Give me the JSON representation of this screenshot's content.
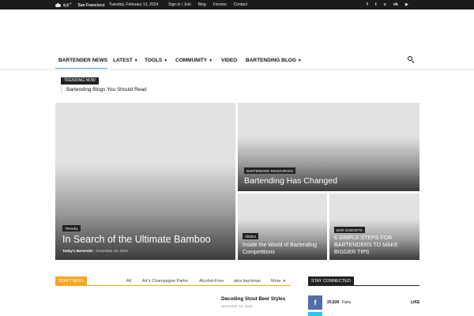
{
  "topbar": {
    "temperature": "9.9",
    "temp_unit": "F",
    "city": "San Francisco",
    "date": "Tuesday, February 13, 2024",
    "links": [
      "Sign in / Join",
      "Blog",
      "Forums",
      "Contact"
    ],
    "social": [
      {
        "icon": "facebook-icon",
        "glyph": "f"
      },
      {
        "icon": "twitter-icon",
        "glyph": "t"
      },
      {
        "icon": "vimeo-icon",
        "glyph": "v"
      },
      {
        "icon": "vk-icon",
        "glyph": "vk"
      },
      {
        "icon": "youtube-icon",
        "glyph": "▶"
      }
    ]
  },
  "nav": {
    "items": [
      {
        "label": "BARTENDER NEWS",
        "dropdown": false
      },
      {
        "label": "LATEST",
        "dropdown": true
      },
      {
        "label": "TOOLS",
        "dropdown": true
      },
      {
        "label": "COMMUNITY",
        "dropdown": true
      },
      {
        "label": "VIDEO",
        "dropdown": false
      },
      {
        "label": "BARTENDING BLOG",
        "dropdown": true
      }
    ],
    "accent_color": "#4db2ec"
  },
  "trending": {
    "label": "TRENDING NOW",
    "headline": "Bartending Blogs You Should Read"
  },
  "featured": [
    {
      "category": "TRAVEL",
      "title": "In Search of the Ultimate Bamboo",
      "author": "Today's Bartender",
      "date": "November 15, 2019"
    },
    {
      "category": "BARTENDING RESOURCES",
      "title": "Bartending Has Changed"
    },
    {
      "category": "VIDEO",
      "title": "Inside the World of Bartending Competitions"
    },
    {
      "category": "BAR GADGETS",
      "title": "6 SIMPLE STEPS FOR BARTENDERS TO MAKE BIGGER TIPS"
    }
  ],
  "dont_miss": {
    "label": "DON'T MISS",
    "tabs": [
      "All",
      "Air's Champagne Parlor",
      "Alcohol-Free",
      "alex bachman"
    ],
    "more_label": "More",
    "post_title": "Decoding Stout Beer Styles",
    "post_date": "November 15, 2019",
    "accent_color": "#f5a623"
  },
  "stay_connected": {
    "label": "STAY CONNECTED",
    "facebook": {
      "glyph": "f",
      "count": "20,830",
      "unit": "Fans",
      "action": "LIKE",
      "color": "#516eab"
    },
    "twitter_color": "#29c5f6"
  }
}
